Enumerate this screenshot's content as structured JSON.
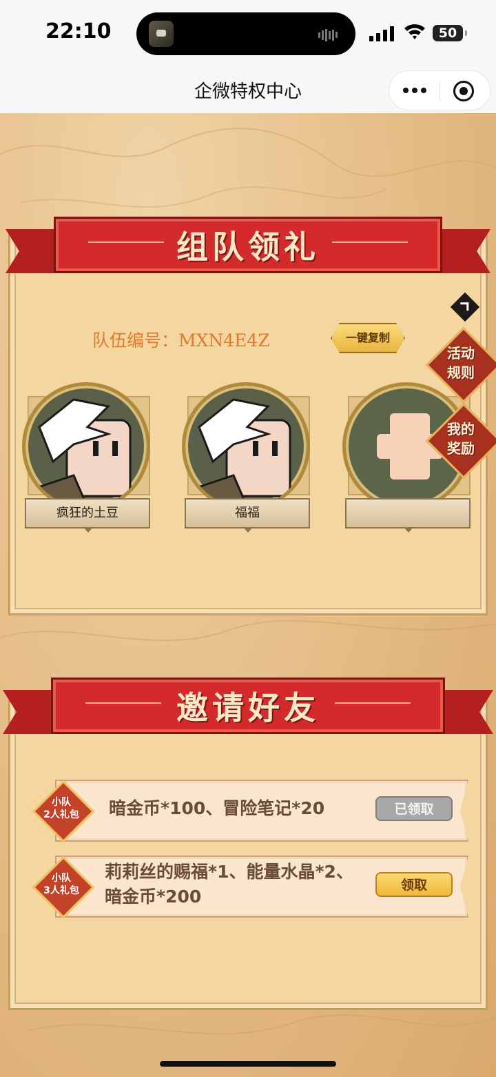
{
  "status_bar": {
    "time": "22:10",
    "battery": "50"
  },
  "nav": {
    "title": "企微特权中心"
  },
  "team_section": {
    "title": "组队领礼",
    "team_id_label": "队伍编号：MXN4E4Z",
    "copy_button": "一键复制",
    "members": [
      {
        "name": "疯狂的土豆"
      },
      {
        "name": "福福"
      },
      {
        "name": ""
      }
    ]
  },
  "side_buttons": {
    "rules": [
      "活动",
      "规则"
    ],
    "rewards": [
      "我的",
      "奖励"
    ]
  },
  "invite_section": {
    "title": "邀请好友",
    "gifts": [
      {
        "badge_top": "小队",
        "badge_bottom": "2人礼包",
        "reward_line1": "暗金币*100、冒险笔记*20",
        "reward_line2": "",
        "button": "已领取",
        "status": "claimed"
      },
      {
        "badge_top": "小队",
        "badge_bottom": "3人礼包",
        "reward_line1": "莉莉丝的赐福*1、能量水晶*2、",
        "reward_line2": "暗金币*200",
        "button": "领取",
        "status": "available"
      }
    ]
  },
  "colors": {
    "ribbon": "#d42a2c",
    "panel": "#f4d6a0",
    "accent_text": "#e07a2c"
  },
  "icons": [
    "more-icon",
    "target-icon",
    "chevron-right-icon",
    "plus-icon",
    "avatar-character-icon"
  ]
}
